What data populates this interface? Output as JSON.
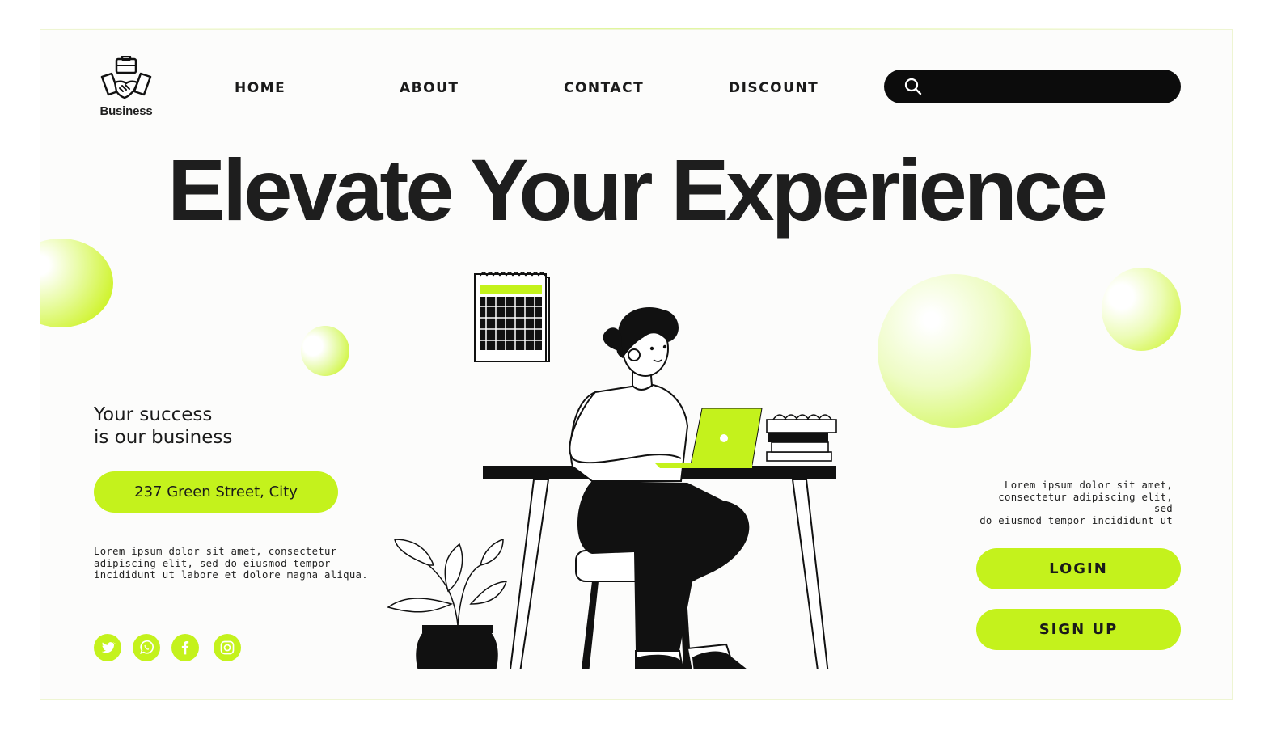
{
  "brand": {
    "name": "Business",
    "accent": "#c4f21c"
  },
  "nav": {
    "items": [
      "HOME",
      "ABOUT",
      "CONTACT",
      "DISCOUNT"
    ]
  },
  "search": {
    "icon": "search-icon",
    "placeholder": ""
  },
  "hero": {
    "headline": "Elevate Your Experience"
  },
  "left": {
    "tagline_line1": "Your success",
    "tagline_line2": "is our business",
    "address": "237 Green Street, City",
    "paragraph_lines": [
      "Lorem ipsum dolor sit amet, consectetur",
      "adipiscing elit, sed do eiusmod tempor",
      "incididunt ut labore et dolore magna aliqua."
    ],
    "social": [
      "twitter-icon",
      "whatsapp-icon",
      "facebook-icon",
      "instagram-icon"
    ]
  },
  "right": {
    "paragraph_lines": [
      "Lorem ipsum dolor sit amet,",
      "consectetur adipiscing elit, sed",
      "do eiusmod tempor incididunt ut"
    ],
    "login_label": "LOGIN",
    "signup_label": "SIGN UP"
  }
}
